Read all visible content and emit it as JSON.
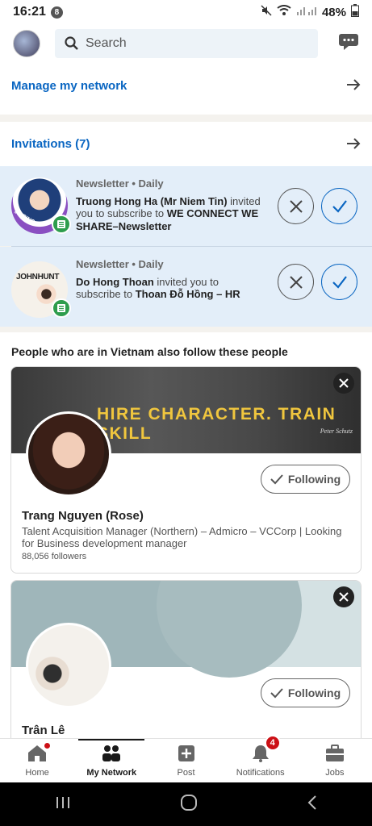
{
  "status_bar": {
    "time": "16:21",
    "notif_count": "8",
    "battery": "48%"
  },
  "top_bar": {
    "search_placeholder": "Search"
  },
  "manage": {
    "label": "Manage my network"
  },
  "invitations": {
    "label": "Invitations (7)",
    "items": [
      {
        "meta": "Newsletter • Daily",
        "sender": "Truong Hong Ha (Mr Niem Tin)",
        "middle": " invited you to subscribe to ",
        "target": "WE CONNECT WE SHARE–Newsletter",
        "avatar_tag": "#HIRING"
      },
      {
        "meta": "Newsletter • Daily",
        "sender": "Do Hong Thoan",
        "middle": " invited you to subscribe to ",
        "target": "Thoan Đỗ Hồng – HR",
        "avatar_tag": "JOHNHUNT"
      }
    ]
  },
  "people": {
    "title": "People who are in Vietnam also follow these people",
    "cards": [
      {
        "banner_text": "HIRE CHARACTER. TRAIN SKILL",
        "banner_sig": "Peter Schutz",
        "name": "Trang Nguyen (Rose)",
        "desc": "Talent Acquisition Manager (Northern) – Admicro – VCCorp | Looking for Business development manager",
        "followers": "88,056 followers",
        "button": "Following"
      },
      {
        "name": "Trân Lê",
        "button": "Following"
      }
    ]
  },
  "tabs": [
    {
      "label": "Home"
    },
    {
      "label": "My Network"
    },
    {
      "label": "Post"
    },
    {
      "label": "Notifications",
      "badge": "4"
    },
    {
      "label": "Jobs"
    }
  ],
  "colors": {
    "brand_blue": "#0a66c2",
    "invite_bg": "#e3eef9",
    "badge_red": "#cc1016",
    "banner_gold": "#f0c63e"
  }
}
